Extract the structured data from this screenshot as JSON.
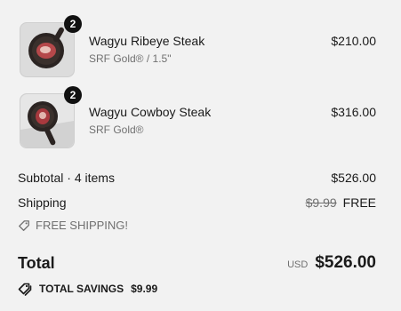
{
  "line_items": [
    {
      "name": "Wagyu Ribeye Steak",
      "variant": "SRF Gold® / 1.5\"",
      "price": "$210.00",
      "quantity": "2"
    },
    {
      "name": "Wagyu Cowboy Steak",
      "variant": "SRF Gold®",
      "price": "$316.00",
      "quantity": "2"
    }
  ],
  "summary": {
    "subtotal_label": "Subtotal · 4 items",
    "subtotal_value": "$526.00",
    "shipping_label": "Shipping",
    "shipping_original": "$9.99",
    "shipping_value": "FREE",
    "free_shipping_text": "FREE SHIPPING!",
    "total_label": "Total",
    "currency": "USD",
    "total_value": "$526.00",
    "savings_label": "TOTAL SAVINGS",
    "savings_value": "$9.99"
  },
  "icons": {
    "tag": "tag-icon",
    "savings_tag": "double-tag-icon"
  }
}
